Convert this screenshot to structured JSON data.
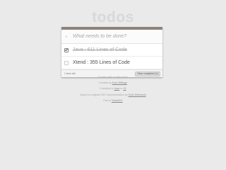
{
  "header": {
    "title": "todos"
  },
  "new_todo": {
    "placeholder": "What needs to be done?",
    "toggle_all_glyph": "»"
  },
  "todos": [
    {
      "label": "Java : 611 Lines of Code",
      "completed": true
    },
    {
      "label": "Xtend : 355 Lines of Code",
      "completed": false
    }
  ],
  "footer": {
    "items_left": "1 item left",
    "clear_button": "Clear completed (1)"
  },
  "info": {
    "line1": "Double-click to edit a todo",
    "line2_prefix": "Created by ",
    "line2_link": "Sven Efftinge",
    "line3_prefix": "Compiled to ",
    "line3_link": "Java",
    "line3_sep": " or ",
    "line3_link2": "JS",
    "line4_prefix": "Based on original GWT implementation by ",
    "line4_link": "Colin Eberhardt",
    "line5_prefix": "Part of ",
    "line5_link": "TodoMVC"
  },
  "colors": {
    "background": "#eaeaea",
    "title": "#d8d8d8",
    "card_topbar": "#8f8379",
    "completed_text": "#a9a9a9",
    "active_text": "#4d4d4d"
  },
  "icons": {
    "toggle_all": "toggle-all-icon",
    "checkbox": "checkbox-icon"
  }
}
